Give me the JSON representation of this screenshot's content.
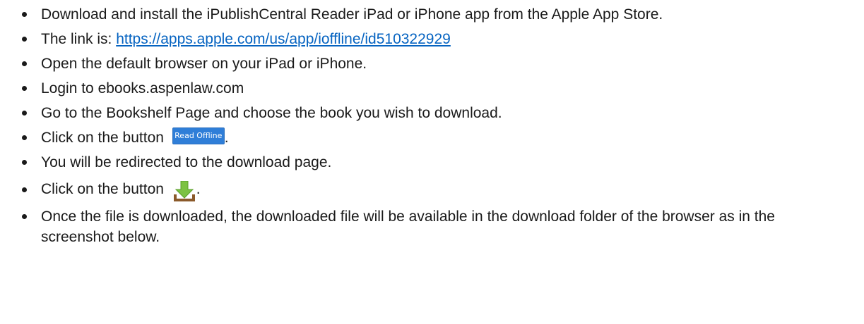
{
  "steps": [
    {
      "text": "Download and install the iPublishCentral Reader iPad or iPhone app from the Apple App Store."
    },
    {
      "prefix": "The link is: ",
      "link": "https://apps.apple.com/us/app/ioffline/id510322929"
    },
    {
      "text": "Open the default browser on your iPad or iPhone."
    },
    {
      "text": "Login to ebooks.aspenlaw.com"
    },
    {
      "text": "Go to the Bookshelf Page and choose the book you wish to download."
    },
    {
      "prefix": "Click on the button ",
      "button_label": "Read Offline",
      "suffix": "."
    },
    {
      "text": "You will be redirected to the download page."
    },
    {
      "prefix": "Click on the button ",
      "icon": "download-arrow-tray-icon",
      "suffix": "."
    },
    {
      "text": "Once the file is downloaded, the downloaded file will be available in the download folder of the browser as in the screenshot below."
    }
  ],
  "colors": {
    "link": "#0563c1",
    "button_bg": "#2f7ed8",
    "arrow_green": "#7cc242",
    "tray_brown": "#8b5a2b"
  }
}
